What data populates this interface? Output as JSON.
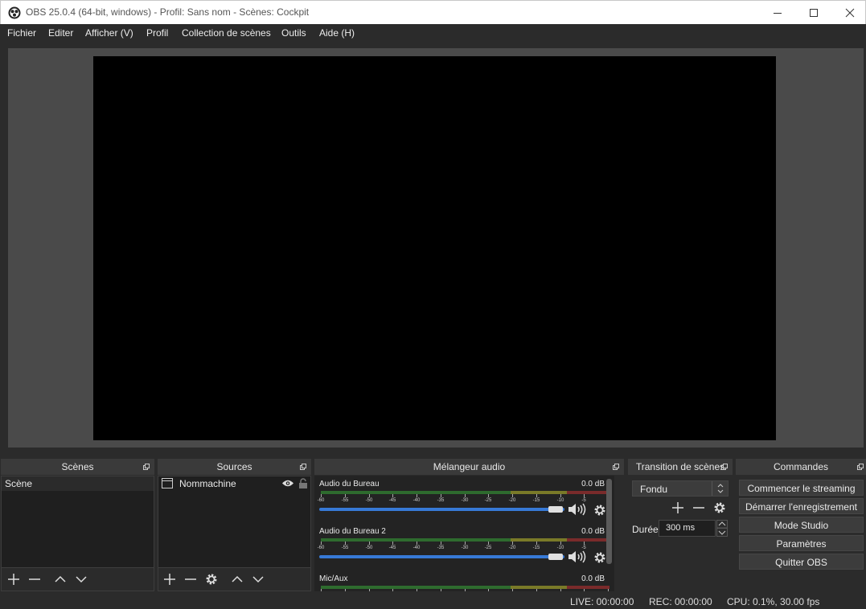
{
  "window": {
    "title": "OBS 25.0.4 (64-bit, windows) - Profil: Sans nom - Scènes: Cockpit"
  },
  "menu": {
    "items": [
      "Fichier",
      "Editer",
      "Afficher (V)",
      "Profil",
      "Collection de scènes",
      "Outils",
      "Aide (H)"
    ]
  },
  "scenes": {
    "title": "Scènes",
    "items": [
      "Scène"
    ]
  },
  "sources": {
    "title": "Sources",
    "items": [
      "Nommachine"
    ]
  },
  "mixer": {
    "title": "Mélangeur audio",
    "channels": [
      {
        "name": "Audio du Bureau",
        "db": "0.0 dB",
        "volume": 1.0
      },
      {
        "name": "Audio du Bureau 2",
        "db": "0.0 dB",
        "volume": 1.0
      },
      {
        "name": "Mic/Aux",
        "db": "0.0 dB",
        "volume": 1.0
      }
    ],
    "scale_labels": [
      "-60",
      "-55",
      "-50",
      "-45",
      "-40",
      "-35",
      "-30",
      "-25",
      "-20",
      "-15",
      "-10",
      "-5",
      "0"
    ]
  },
  "transitions": {
    "title": "Transition de scènes",
    "selected": "Fondu",
    "duration_label": "Durée",
    "duration_value": "300 ms"
  },
  "controls": {
    "title": "Commandes",
    "buttons": [
      "Commencer le streaming",
      "Démarrer l'enregistrement",
      "Mode Studio",
      "Paramètres",
      "Quitter OBS"
    ]
  },
  "status": {
    "live": "LIVE: 00:00:00",
    "rec": "REC: 00:00:00",
    "cpu": "CPU: 0.1%, 30.00 fps"
  },
  "colors": {
    "background": "#2b2b2b",
    "panel": "#1f1f1f",
    "slider": "#3779d6",
    "meter_green": "#2e6b2e",
    "meter_yellow": "#7a7a28",
    "meter_red": "#7a2b2b"
  }
}
